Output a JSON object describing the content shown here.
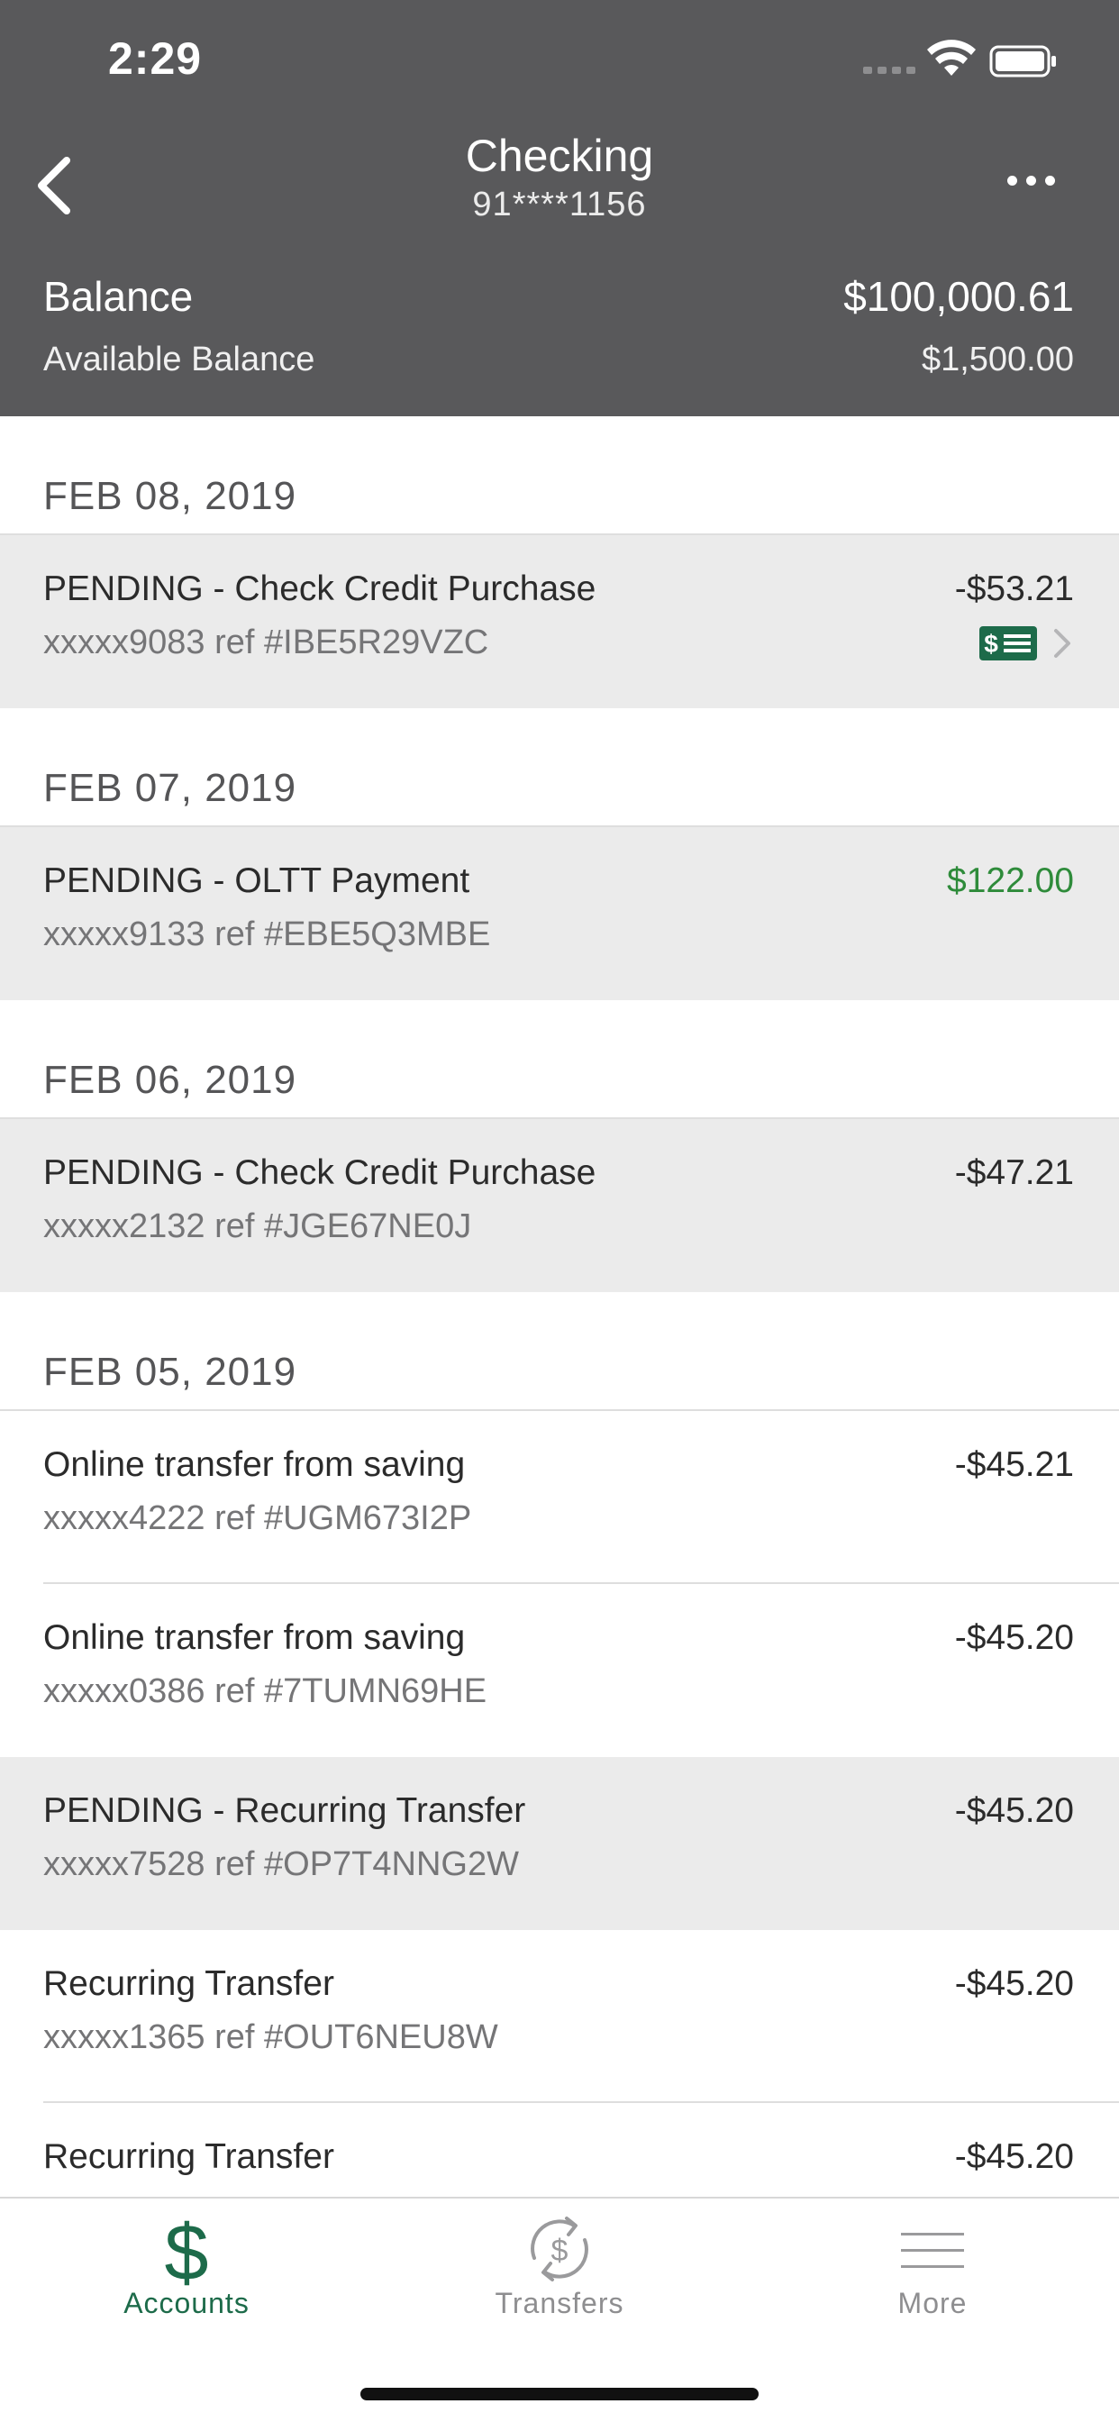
{
  "status_bar": {
    "time": "2:29"
  },
  "account": {
    "title": "Checking",
    "number": "91****1156",
    "balance_label": "Balance",
    "balance_value": "$100,000.61",
    "available_label": "Available Balance",
    "available_value": "$1,500.00"
  },
  "sections": [
    {
      "date": "FEB 08, 2019",
      "transactions": [
        {
          "description": "PENDING - Check Credit Purchase",
          "ref": "xxxxx9083 ref #IBE5R29VZC",
          "amount": "-$53.21"
        }
      ]
    },
    {
      "date": "FEB 07, 2019",
      "transactions": [
        {
          "description": "PENDING - OLTT Payment",
          "ref": "xxxxx9133 ref #EBE5Q3MBE",
          "amount": "$122.00"
        }
      ]
    },
    {
      "date": "FEB 06, 2019",
      "transactions": [
        {
          "description": "PENDING - Check Credit Purchase",
          "ref": "xxxxx2132 ref #JGE67NE0J",
          "amount": "-$47.21"
        }
      ]
    },
    {
      "date": "FEB 05, 2019",
      "transactions": [
        {
          "description": "Online transfer from saving",
          "ref": "xxxxx4222 ref #UGM673I2P",
          "amount": "-$45.21"
        },
        {
          "description": "Online transfer from saving",
          "ref": "xxxxx0386 ref #7TUMN69HE",
          "amount": "-$45.20"
        },
        {
          "description": "PENDING - Recurring Transfer",
          "ref": "xxxxx7528 ref #OP7T4NNG2W",
          "amount": "-$45.20"
        },
        {
          "description": "Recurring Transfer",
          "ref": "xxxxx1365 ref #OUT6NEU8W",
          "amount": "-$45.20"
        },
        {
          "description": "Recurring Transfer",
          "ref": "",
          "amount": "-$45.20"
        }
      ]
    }
  ],
  "tabs": [
    {
      "label": "Accounts",
      "icon": "dollar-icon"
    },
    {
      "label": "Transfers",
      "icon": "transfer-cycle-icon"
    },
    {
      "label": "More",
      "icon": "menu-lines-icon"
    }
  ],
  "colors": {
    "header_bg": "#59595b",
    "brand_green": "#1d6b4a",
    "credit_green": "#2e8b3a",
    "pending_bg": "#ebebeb"
  }
}
